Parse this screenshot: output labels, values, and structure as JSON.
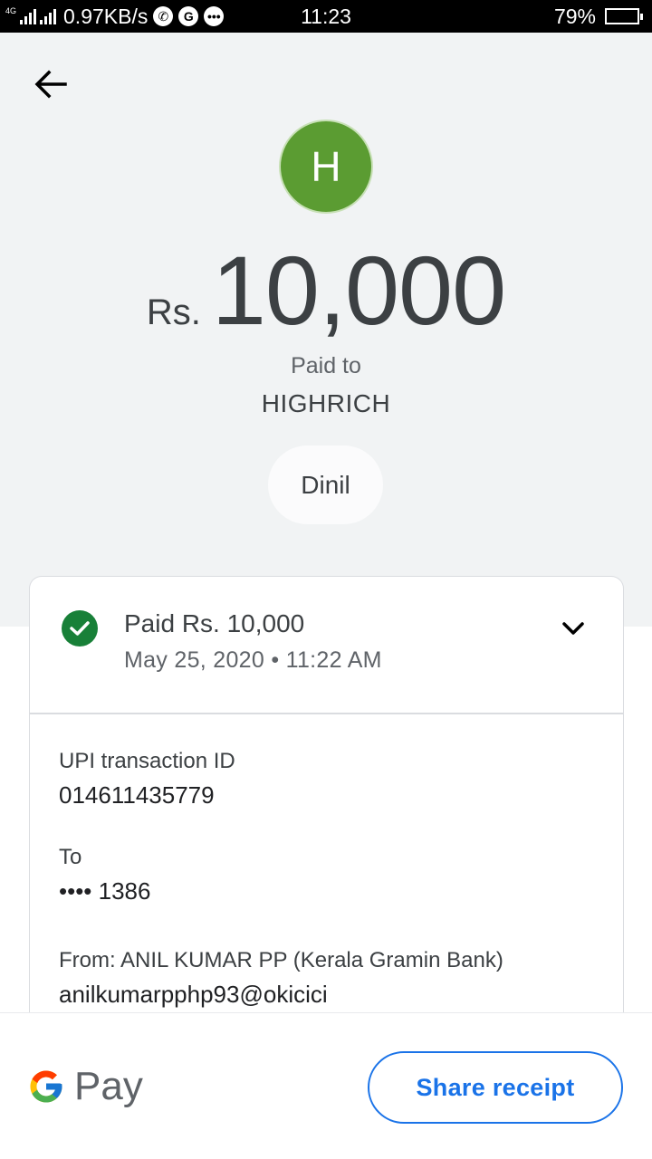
{
  "status_bar": {
    "network": "4G",
    "speed": "0.97KB/s",
    "time": "11:23",
    "battery": "79%",
    "battery_level": 0.79,
    "icons": [
      "whatsapp-icon",
      "g-icon",
      "message-icon"
    ]
  },
  "header": {
    "avatar_letter": "H",
    "avatar_color": "#5b9c32",
    "currency": "Rs.",
    "amount": "10,000",
    "paid_to_label": "Paid to",
    "payee": "HIGHRICH",
    "note": "Dinil"
  },
  "transaction": {
    "status_title": "Paid Rs. 10,000",
    "datetime": "May 25, 2020 • 11:22 AM",
    "status_color": "#188038",
    "upi_label": "UPI transaction ID",
    "upi_id": "014611435779",
    "to_label": "To",
    "to_account": "•••• 1386",
    "from_label": "From: ANIL KUMAR PP (Kerala Gramin Bank)",
    "from_vpa": "anilkumarpphp93@okicici"
  },
  "footer": {
    "brand": "Pay",
    "share_label": "Share receipt",
    "accent": "#1a73e8"
  }
}
